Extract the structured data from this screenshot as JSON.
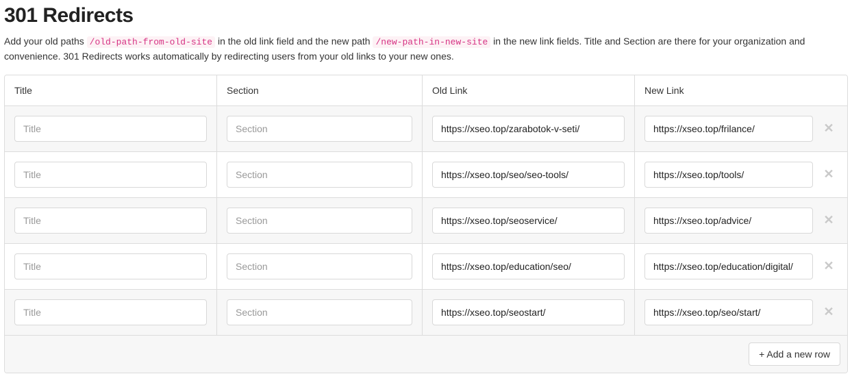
{
  "heading": "301 Redirects",
  "desc_1": "Add your old paths ",
  "desc_code_1": "/old-path-from-old-site",
  "desc_2": " in the old link field and the new path ",
  "desc_code_2": "/new-path-in-new-site",
  "desc_3": " in the new link fields. Title and Section are there for your organization and convenience. 301 Redirects works automatically by redirecting users from your old links to your new ones.",
  "columns": {
    "title": "Title",
    "section": "Section",
    "old": "Old Link",
    "new": "New Link"
  },
  "placeholders": {
    "title": "Title",
    "section": "Section"
  },
  "rows": [
    {
      "title": "",
      "section": "",
      "old": "https://xseo.top/zarabotok-v-seti/",
      "new": "https://xseo.top/frilance/"
    },
    {
      "title": "",
      "section": "",
      "old": "https://xseo.top/seo/seo-tools/",
      "new": "https://xseo.top/tools/"
    },
    {
      "title": "",
      "section": "",
      "old": "https://xseo.top/seoservice/",
      "new": "https://xseo.top/advice/"
    },
    {
      "title": "",
      "section": "",
      "old": "https://xseo.top/education/seo/",
      "new": "https://xseo.top/education/digital/"
    },
    {
      "title": "",
      "section": "",
      "old": "https://xseo.top/seostart/",
      "new": "https://xseo.top/seo/start/"
    }
  ],
  "buttons": {
    "delete": "✕",
    "add": "+ Add a new row"
  }
}
